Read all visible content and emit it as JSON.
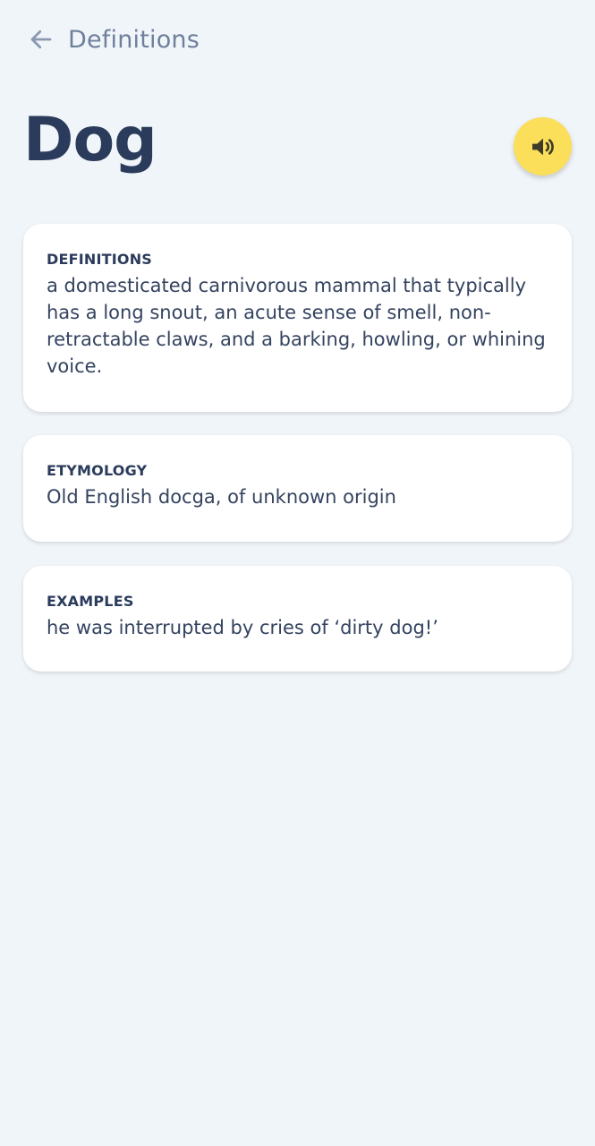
{
  "header": {
    "title": "Definitions",
    "back_icon": "arrow-left-icon"
  },
  "word": {
    "text": "Dog",
    "speak_icon": "speaker-icon"
  },
  "cards": {
    "definitions": {
      "label": "DEFINITIONS",
      "text": "a domesticated carnivorous mammal that typically has a long snout, an acute sense of smell, non-retractable claws, and a barking, howling, or whining voice."
    },
    "etymology": {
      "label": "ETYMOLOGY",
      "text": "Old English docga, of unknown origin"
    },
    "examples": {
      "label": "EXAMPLES",
      "text": "he was interrupted by cries of ‘dirty dog!’"
    }
  },
  "colors": {
    "background": "#f0f5f9",
    "text_primary": "#2b3b5c",
    "text_muted": "#6f7f9c",
    "accent": "#fbde59"
  }
}
